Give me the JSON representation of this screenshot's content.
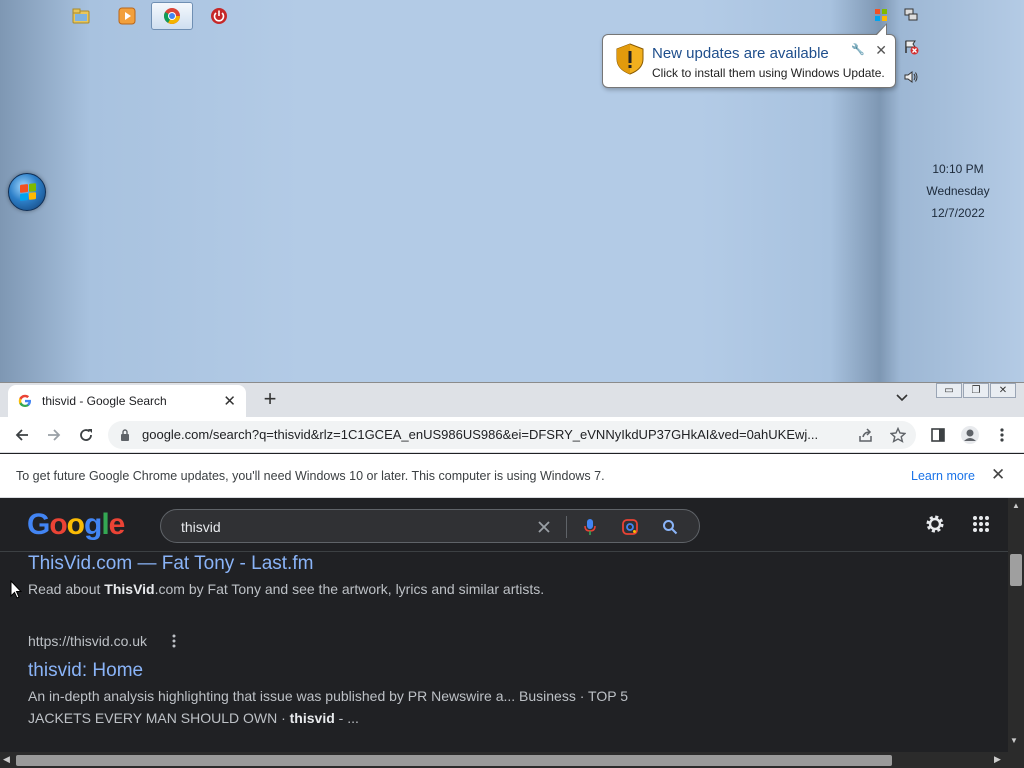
{
  "taskbar": {
    "apps": [
      {
        "name": "Windows Explorer",
        "icon": "folder-icon"
      },
      {
        "name": "Windows Media Player",
        "icon": "media-player-icon"
      },
      {
        "name": "Google Chrome",
        "icon": "chrome-icon",
        "active": true
      },
      {
        "name": "Power",
        "icon": "power-icon"
      }
    ]
  },
  "tray": {
    "icons": [
      "windows-update-icon",
      "network-icon",
      "action-center-icon",
      "volume-icon"
    ]
  },
  "clock": {
    "time": "10:10 PM",
    "day": "Wednesday",
    "date": "12/7/2022"
  },
  "notification": {
    "title": "New updates are available",
    "body": "Click to install them using Windows Update."
  },
  "browser": {
    "tab_title": "thisvid - Google Search",
    "url": "google.com/search?q=thisvid&rlz=1C1GCEA_enUS986US986&ei=DFSRY_eVNNyIkdUP37GHkAI&ved=0ahUKEwj...",
    "infobar_message": "To get future Google Chrome updates, you'll need Windows 10 or later. This computer is using Windows 7.",
    "infobar_link": "Learn more"
  },
  "search": {
    "logo": "Google",
    "query": "thisvid"
  },
  "results": [
    {
      "title": "ThisVid.com — Fat Tony - Last.fm",
      "snippet_pre": "Read about ",
      "snippet_bold": "ThisVid",
      "snippet_post": ".com by Fat Tony and see the artwork, lyrics and similar artists."
    },
    {
      "url": "https://thisvid.co.uk",
      "title": "thisvid: Home",
      "snippet_line1": "An in-depth analysis highlighting that issue was published by PR Newswire a... Business · TOP 5",
      "snippet_line2_pre": "JACKETS EVERY MAN SHOULD OWN · ",
      "snippet_line2_bold": "thisvid",
      "snippet_line2_post": " - ..."
    }
  ],
  "colors": {
    "link": "#8ab4f8",
    "page_bg": "#202124",
    "balloon_title": "#1e4e8c"
  }
}
